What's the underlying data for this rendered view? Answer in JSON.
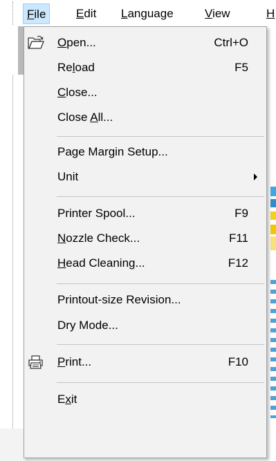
{
  "menubar": {
    "items": [
      {
        "pre": "",
        "mn": "F",
        "post": "ile"
      },
      {
        "pre": "",
        "mn": "E",
        "post": "dit"
      },
      {
        "pre": "",
        "mn": "L",
        "post": "anguage"
      },
      {
        "pre": "",
        "mn": "V",
        "post": "iew"
      },
      {
        "pre": "",
        "mn": "H",
        "post": ""
      }
    ]
  },
  "file_menu": {
    "open": {
      "pre": "",
      "mn": "O",
      "post": "pen...",
      "shortcut": "Ctrl+O",
      "icon": "folder-open-icon"
    },
    "reload": {
      "pre": "Re",
      "mn": "l",
      "post": "oad",
      "shortcut": "F5"
    },
    "close": {
      "pre": "",
      "mn": "C",
      "post": "lose..."
    },
    "close_all": {
      "pre": "Close ",
      "mn": "A",
      "post": "ll..."
    },
    "page_margin": {
      "pre": "Page Margin Setup...",
      "mn": "",
      "post": ""
    },
    "unit": {
      "pre": "Unit",
      "mn": "",
      "post": ""
    },
    "printer_spool": {
      "pre": "Printer Spool...",
      "mn": "",
      "post": "",
      "shortcut": "F9"
    },
    "nozzle_check": {
      "pre": "",
      "mn": "N",
      "post": "ozzle Check...",
      "shortcut": "F11"
    },
    "head_cleaning": {
      "pre": "",
      "mn": "H",
      "post": "ead Cleaning...",
      "shortcut": "F12"
    },
    "printout_revision": {
      "pre": "Printout-size Revision...",
      "mn": "",
      "post": ""
    },
    "dry_mode": {
      "pre": "Dry Mode...",
      "mn": "",
      "post": ""
    },
    "print": {
      "pre": "",
      "mn": "P",
      "post": "rint...",
      "shortcut": "F10",
      "icon": "printer-icon"
    },
    "exit": {
      "pre": "E",
      "mn": "x",
      "post": "it"
    }
  },
  "colors": {
    "menu_bg": "#f2f2f2",
    "active_menu_bg": "#cce8ff",
    "active_menu_border": "#99d1ff",
    "separator": "#c4c4c4"
  }
}
